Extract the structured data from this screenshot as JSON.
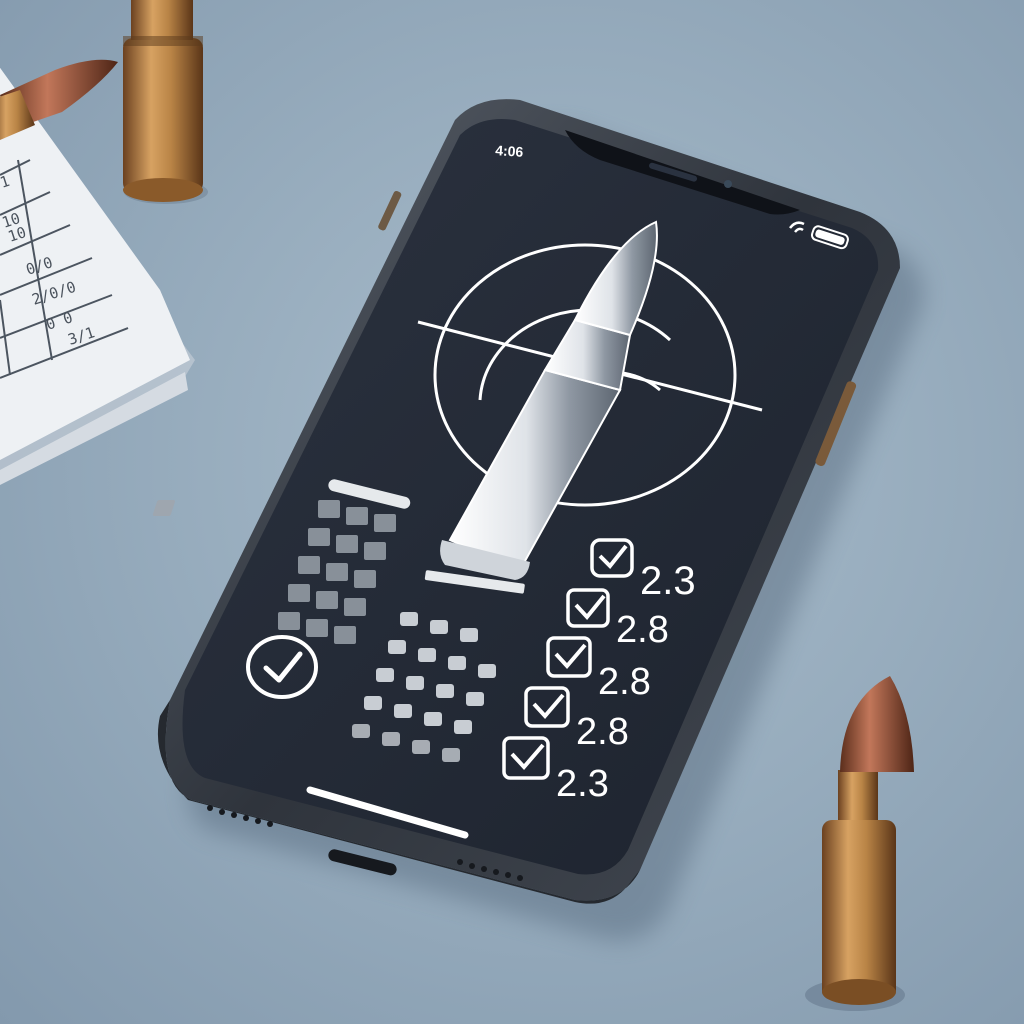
{
  "status_bar": {
    "time": "4:06"
  },
  "grid_widget": {
    "icon": "calendar-grid-icon"
  },
  "check_widget": {
    "icon": "check-circle-icon"
  },
  "target_widget": {
    "icon": "crosshair-target-icon",
    "bullet_icon": "bullet-cartridge-icon"
  },
  "checklist": {
    "items": [
      {
        "value": "2.3",
        "checked": true
      },
      {
        "value": "2.8",
        "checked": true
      },
      {
        "value": "2.8",
        "checked": true
      },
      {
        "value": "2.8",
        "checked": true
      },
      {
        "value": "2.3",
        "checked": true
      }
    ]
  },
  "paper_note": {
    "rows": [
      "1",
      "10",
      "10",
      "0/0",
      "2/0/0",
      "0 0",
      "3/1"
    ]
  },
  "colors": {
    "screen": "#232a36",
    "frame": "#3a4049",
    "brass": "#b98446",
    "background": "#98adbe"
  }
}
